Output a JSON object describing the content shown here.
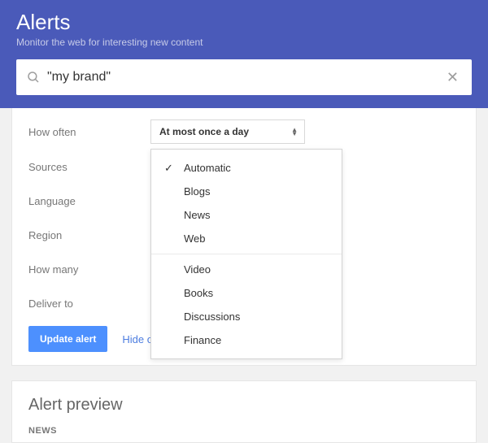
{
  "header": {
    "title": "Alerts",
    "subtitle": "Monitor the web for interesting new content"
  },
  "search": {
    "value": "\"my brand\""
  },
  "form": {
    "rows": [
      {
        "label": "How often",
        "select": "At most once a day"
      },
      {
        "label": "Sources"
      },
      {
        "label": "Language"
      },
      {
        "label": "Region"
      },
      {
        "label": "How many"
      },
      {
        "label": "Deliver to"
      }
    ]
  },
  "dropdown": {
    "section1": [
      {
        "label": "Automatic",
        "checked": true
      },
      {
        "label": "Blogs"
      },
      {
        "label": "News"
      },
      {
        "label": "Web"
      }
    ],
    "section2": [
      {
        "label": "Video"
      },
      {
        "label": "Books"
      },
      {
        "label": "Discussions"
      },
      {
        "label": "Finance"
      }
    ]
  },
  "actions": {
    "update": "Update alert",
    "hide": "Hide options"
  },
  "preview": {
    "title": "Alert preview",
    "tag": "NEWS"
  }
}
